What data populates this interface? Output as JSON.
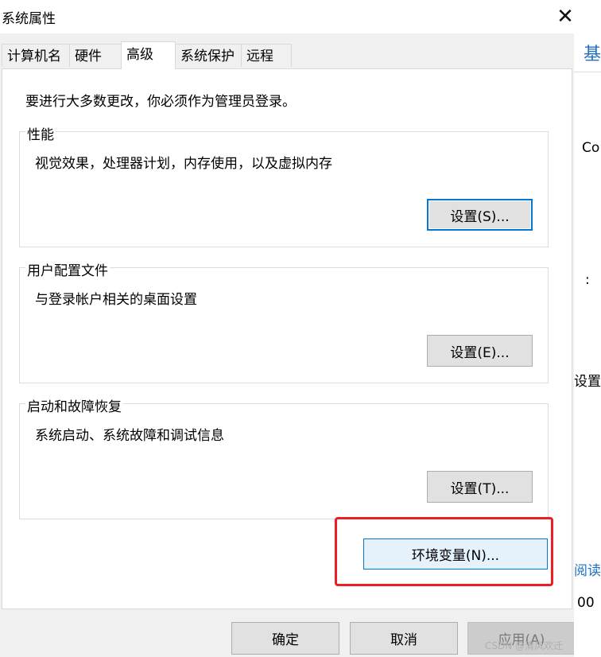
{
  "window": {
    "title": "系统属性",
    "close_glyph": "✕"
  },
  "tabs": [
    {
      "label": "计算机名",
      "active": false
    },
    {
      "label": "硬件",
      "active": false
    },
    {
      "label": "高级",
      "active": true
    },
    {
      "label": "系统保护",
      "active": false
    },
    {
      "label": "远程",
      "active": false
    }
  ],
  "intro": "要进行大多数更改，你必须作为管理员登录。",
  "groups": {
    "performance": {
      "title": "性能",
      "desc": "视觉效果，处理器计划，内存使用，以及虚拟内存",
      "button": "设置(S)..."
    },
    "profiles": {
      "title": "用户配置文件",
      "desc": "与登录帐户相关的桌面设置",
      "button": "设置(E)..."
    },
    "startup": {
      "title": "启动和故障恢复",
      "desc": "系统启动、系统故障和调试信息",
      "button": "设置(T)..."
    }
  },
  "env_button": "环境变量(N)...",
  "footer": {
    "ok": "确定",
    "cancel": "取消",
    "apply": "应用(A)"
  },
  "background": {
    "t1": "基",
    "t2": "Co",
    "t3": ":",
    "t4": "设置",
    "t5": "阅读",
    "t6": "00"
  },
  "watermark": "CSDN @清风欢迁",
  "colors": {
    "accent": "#0078d7",
    "highlight": "#ee1c24",
    "dialog_bg": "#f0f0f0"
  }
}
